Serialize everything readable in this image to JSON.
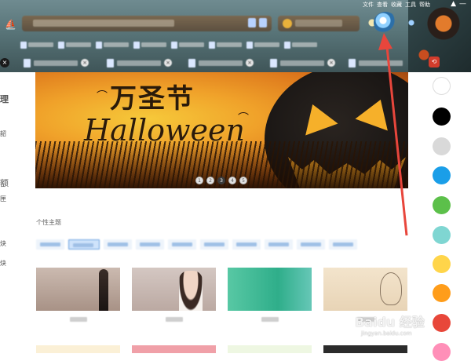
{
  "browser": {
    "menu": [
      "文件",
      "查看",
      "收藏",
      "工具",
      "帮助"
    ],
    "window_buttons": [
      "▲",
      "—"
    ],
    "address_text": "",
    "search_placeholder": "",
    "tabs_close_glyph": "×",
    "tab_close_glyph": "×"
  },
  "banner": {
    "title_cn": "万圣节",
    "title_en": "Halloween",
    "dots": [
      "1",
      "2",
      "3",
      "4",
      "5"
    ],
    "active_dot": 2
  },
  "colors": {
    "swatches": [
      "#ffffff",
      "#000000",
      "#d9d9d9",
      "#1a9ee8",
      "#5cc04a",
      "#7fd6d2",
      "#ffd54a",
      "#ff9d1a",
      "#e8473a",
      "#ff8fb8"
    ]
  },
  "themes": {
    "section_title": "个性主题",
    "categories": [
      "",
      "",
      "",
      "",
      "",
      "",
      "",
      "",
      "",
      ""
    ],
    "active_category": 1,
    "items": [
      {
        "label": "",
        "color": "#b8a59a"
      },
      {
        "label": "",
        "color": "#c9b9b4"
      },
      {
        "label": "",
        "color": "#3dbb8f"
      },
      {
        "label": "",
        "color": "#eedbc2"
      }
    ]
  },
  "watermark": {
    "main": "Baidu 经验",
    "sub": "jingyan.baidu.com"
  }
}
